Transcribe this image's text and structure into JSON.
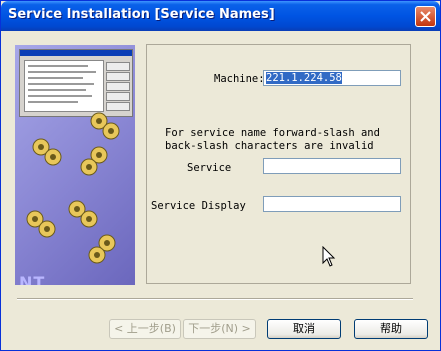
{
  "window": {
    "title": "Service Installation [Service Names]"
  },
  "art": {
    "watermark": "NT Services"
  },
  "form": {
    "machine_label": "Machine:",
    "machine_value": "221.1.224.58",
    "note_line1": "For service name forward-slash and",
    "note_line2": "back-slash characters are invalid",
    "service_label": "Service",
    "service_value": "",
    "display_label": "Service Display",
    "display_value": ""
  },
  "buttons": {
    "back": "< 上一步(B)",
    "next": "下一步(N) >",
    "cancel": "取消",
    "help": "帮助"
  },
  "colors": {
    "titlebar": "#0054e3",
    "selection": "#316ac5",
    "art": "#8a87d4"
  }
}
